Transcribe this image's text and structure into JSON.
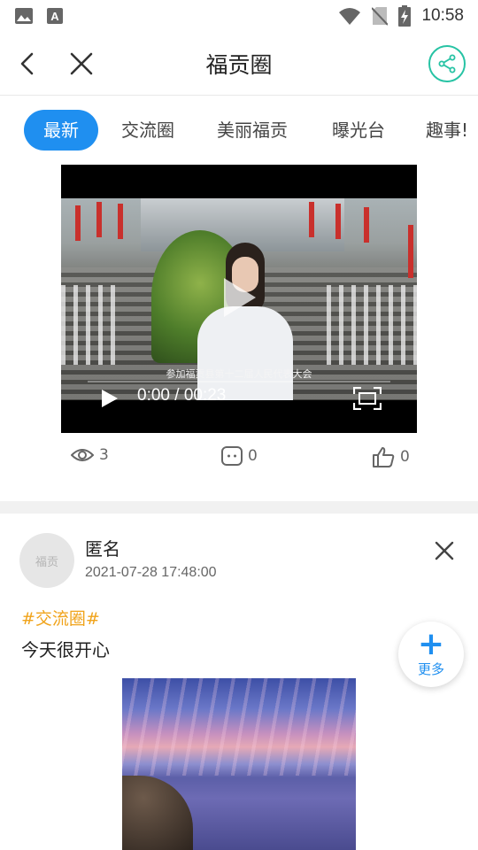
{
  "status_bar": {
    "time": "10:58"
  },
  "header": {
    "title": "福贡圈"
  },
  "tabs": [
    {
      "label": "最新",
      "active": true
    },
    {
      "label": "交流圈"
    },
    {
      "label": "美丽福贡"
    },
    {
      "label": "曝光台"
    },
    {
      "label": "趣事!"
    }
  ],
  "video": {
    "subtitle": "参加福贡县第十二届人民代表大会",
    "timecode": "0:00 / 00:23"
  },
  "stats": {
    "views": "3",
    "comments": "0",
    "likes": "0"
  },
  "post": {
    "author": "匿名",
    "date": "2021-07-28 17:48:00",
    "hashtag": "#交流圈#",
    "text": "今天很开心",
    "avatar_text": "福贡"
  },
  "fab": {
    "label": "更多"
  },
  "colors": {
    "accent_blue": "#1f8ff0",
    "share_green": "#27c3a4",
    "hashtag_orange": "#f0a31a"
  }
}
